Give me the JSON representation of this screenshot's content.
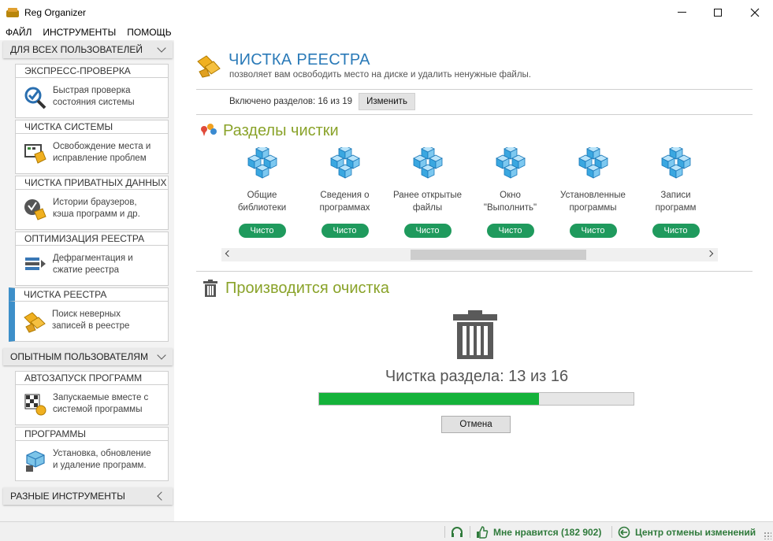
{
  "window": {
    "title": "Reg Organizer"
  },
  "menu": {
    "items": [
      "ФАЙЛ",
      "ИНСТРУМЕНТЫ",
      "ПОМОЩЬ"
    ]
  },
  "sidebar": {
    "group_all": "ДЛЯ ВСЕХ ПОЛЬЗОВАТЕЛЕЙ",
    "group_advanced": "ОПЫТНЫМ ПОЛЬЗОВАТЕЛЯМ",
    "group_misc": "РАЗНЫЕ ИНСТРУМЕНТЫ",
    "cards": [
      {
        "title": "ЭКСПРЕСС-ПРОВЕРКА",
        "line1": "Быстрая проверка",
        "line2": "состояния системы",
        "icon": "checkmark-magnifier-icon"
      },
      {
        "title": "ЧИСТКА СИСТЕМЫ",
        "line1": "Освобождение места и",
        "line2": "исправление проблем",
        "icon": "system-cleanup-icon"
      },
      {
        "title": "ЧИСТКА ПРИВАТНЫХ ДАННЫХ",
        "line1": "Истории браузеров,",
        "line2": "кэша программ и др.",
        "icon": "privacy-cleanup-icon"
      },
      {
        "title": "ОПТИМИЗАЦИЯ РЕЕСТРА",
        "line1": "Дефрагментация и",
        "line2": "сжатие реестра",
        "icon": "registry-defrag-icon"
      },
      {
        "title": "ЧИСТКА РЕЕСТРА",
        "line1": "Поиск неверных",
        "line2": "записей в реестре",
        "icon": "registry-clean-icon"
      },
      {
        "title": "АВТОЗАПУСК ПРОГРАММ",
        "line1": "Запускаемые вместе с",
        "line2": "системой программы",
        "icon": "autorun-icon"
      },
      {
        "title": "ПРОГРАММЫ",
        "line1": "Установка, обновление",
        "line2": "и удаление программ.",
        "icon": "programs-icon"
      }
    ]
  },
  "main": {
    "title": "ЧИСТКА РЕЕСТРА",
    "subtitle": "позволяет вам освободить место на диске и удалить ненужные файлы.",
    "included_label": "Включено разделов: 16 из 19",
    "change_button": "Изменить",
    "sections_title": "Разделы чистки",
    "tiles": [
      {
        "line1": "Общие",
        "line2": "библиотеки",
        "status": "Чисто"
      },
      {
        "line1": "Сведения о",
        "line2": "программах",
        "status": "Чисто"
      },
      {
        "line1": "Ранее открытые",
        "line2": "файлы",
        "status": "Чисто"
      },
      {
        "line1": "Окно",
        "line2": "\"Выполнить\"",
        "status": "Чисто"
      },
      {
        "line1": "Установленные",
        "line2": "программы",
        "status": "Чисто"
      },
      {
        "line1": "Записи",
        "line2": "программ",
        "status": "Чисто"
      }
    ],
    "process_title": "Производится очистка",
    "clean_status": "Чистка раздела: 13 из 16",
    "progress_fraction": 0.7,
    "cancel_button": "Отмена"
  },
  "statusbar": {
    "like": "Мне нравится (182 902)",
    "undo_center": "Центр отмены изменений"
  },
  "colors": {
    "accent_blue": "#2a7ab8",
    "section_green": "#8aa32a",
    "status_green": "#1f9a5d",
    "progress_green": "#14b23a"
  }
}
